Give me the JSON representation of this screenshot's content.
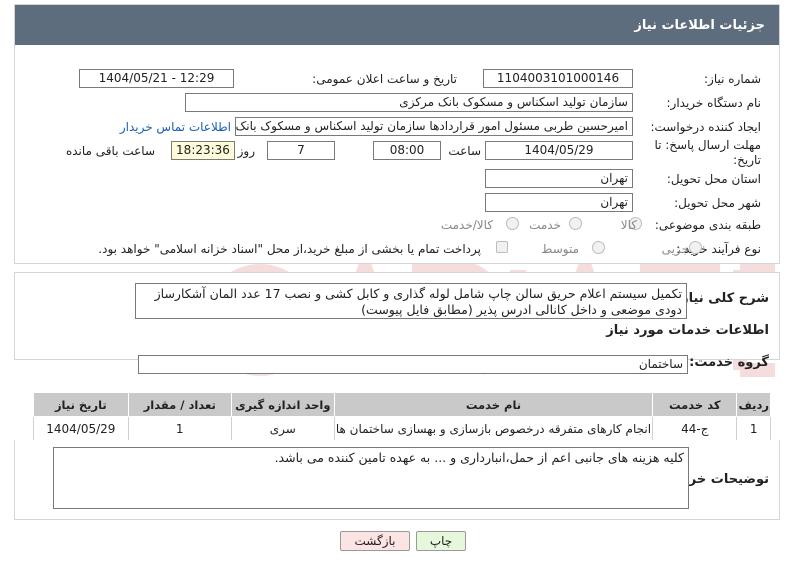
{
  "header": {
    "title": "جزئیات اطلاعات نیاز"
  },
  "fields": {
    "need_number_label": "شماره نیاز:",
    "need_number": "1104003101000146",
    "announce_label": "تاریخ و ساعت اعلان عمومی:",
    "announce_value": "1404/05/21 - 12:29",
    "buyer_org_label": "نام دستگاه خریدار:",
    "buyer_org": "سازمان تولید اسکناس و مسکوک بانک مرکزی",
    "creator_label": "ایجاد کننده درخواست:",
    "creator": "امیرحسین طربی مسئول امور قراردادها سازمان تولید اسکناس و مسکوک بانک مرکزی",
    "contact_link": "اطلاعات تماس خریدار",
    "deadline_label_1": "مهلت ارسال پاسخ: تا",
    "deadline_label_2": "تاریخ:",
    "deadline_date": "1404/05/29",
    "time_label": "ساعت",
    "deadline_time": "08:00",
    "days_value": "7",
    "days_label": "روز و",
    "remaining_time": "18:23:36",
    "remaining_label": "ساعت باقی مانده",
    "province_label": "استان محل تحویل:",
    "province": "تهران",
    "city_label": "شهر محل تحویل:",
    "city": "تهران",
    "category_label": "طبقه بندی موضوعی:",
    "category_options": [
      "کالا",
      "خدمت",
      "کالا/خدمت"
    ],
    "process_label": "نوع فرآیند خرید :",
    "process_options": [
      "جزیی",
      "متوسط"
    ],
    "payment_note": "پرداخت تمام یا بخشی از مبلغ خرید،از محل \"اسناد خزانه اسلامی\" خواهد بود."
  },
  "summary": {
    "label": "شرح کلی نیاز:",
    "text": "تکمیل سیستم اعلام حریق سالن چاپ شامل لوله گذاری و کابل کشی و نصب 17 عدد المان آشکارساز دودی موضعی و داخل کانالی ادرس پذیر (مطابق فایل پیوست)"
  },
  "services": {
    "title": "اطلاعات خدمات مورد نیاز",
    "group_label": "گروه خدمت:",
    "group_value": "ساختمان",
    "columns": [
      "ردیف",
      "کد خدمت",
      "نام خدمت",
      "واحد اندازه گیری",
      "تعداد / مقدار",
      "تاریخ نیاز"
    ],
    "rows": [
      [
        "1",
        "ج-44",
        "انجام کارهای متفرقه درخصوص بازسازی و بهسازی ساختمان ها",
        "سری",
        "1",
        "1404/05/29"
      ]
    ]
  },
  "buyer_notes": {
    "label": "توضیحات خریدار:",
    "text": "کلیه هزینه های جانبی اعم از حمل،انبارداری و ... به عهده تامین کننده می باشد."
  },
  "buttons": {
    "print": "چاپ",
    "back": "بازگشت"
  },
  "colors": {
    "header_bg": "#5d6d7e",
    "table_head": "#c9c9c9",
    "remaining_bg": "#fdfbd9",
    "print_bg": "#e6f7dc",
    "back_bg": "#fde4e4"
  }
}
